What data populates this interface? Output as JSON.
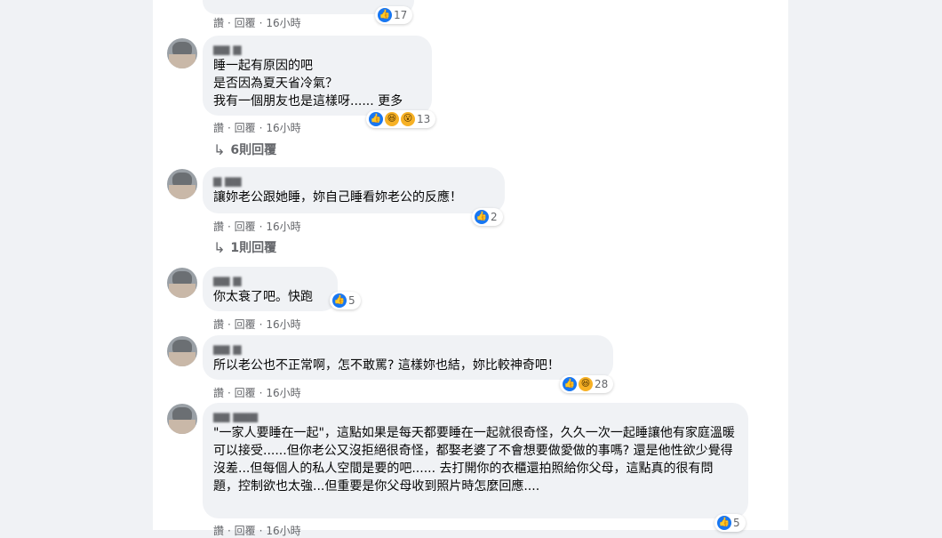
{
  "top_comment": {
    "react_count": "17",
    "meta": {
      "like": "讚",
      "reply": "回覆",
      "time": "16小時"
    }
  },
  "comments": [
    {
      "text": "睡一起有原因的吧\n是否因為夏天省冷氣？\n我有一個朋友也是這樣呀...... 更多",
      "react_count": "13",
      "meta": {
        "like": "讚",
        "reply": "回覆",
        "time": "16小時"
      },
      "replies": "6則回覆"
    },
    {
      "text": "讓妳老公跟她睡，妳自己睡看妳老公的反應！",
      "react_count": "2",
      "meta": {
        "like": "讚",
        "reply": "回覆",
        "time": "16小時"
      },
      "replies": "1則回覆"
    },
    {
      "text": "你太衰了吧。快跑",
      "react_count": "5",
      "meta": {
        "like": "讚",
        "reply": "回覆",
        "time": "16小時"
      }
    },
    {
      "text": "所以老公也不正常啊，怎不敢罵? 這樣妳也結，妳比較神奇吧！",
      "react_count": "28",
      "meta": {
        "like": "讚",
        "reply": "回覆",
        "time": "16小時"
      }
    },
    {
      "text": "\"一家人要睡在一起\"，這點如果是每天都要睡在一起就很奇怪，久久一次一起睡讓他有家庭溫暖可以接受......但你老公又沒拒絕很奇怪，都娶老婆了不會想要做愛做的事嗎? 還是他性欲少覺得沒差...但每個人的私人空間是要的吧...... 去打開你的衣櫃還拍照給你父母，這點真的很有問題，控制欲也太強...但重要是你父母收到照片時怎麼回應....",
      "react_count": "5",
      "meta": {
        "like": "讚",
        "reply": "回覆",
        "time": "16小時"
      }
    }
  ]
}
